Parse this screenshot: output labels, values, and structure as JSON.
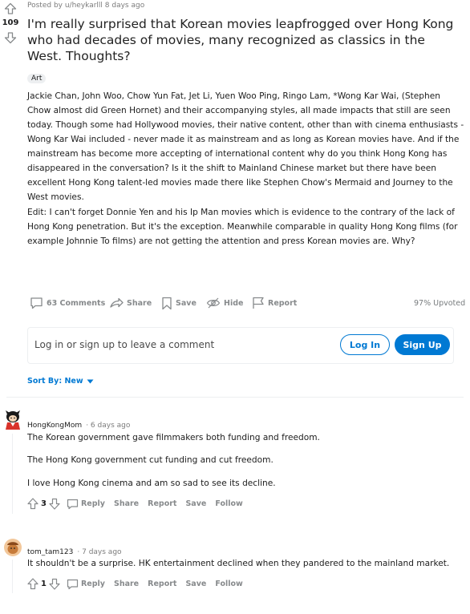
{
  "post": {
    "posted_by": "Posted by u/heykarlll 8 days ago",
    "score": "109",
    "title": "I'm really surprised that Korean movies leapfrogged over Hong Kong who had decades of movies, many recognized as classics in the West. Thoughts?",
    "flair": "Art",
    "body_p1": "Jackie Chan, John Woo, Chow Yun Fat, Jet Li, Yuen Woo Ping, Ringo Lam, *Wong Kar Wai, (Stephen Chow almost did Green Hornet) and their accompanying styles, all made impacts that still are seen today. Though some had Hollywood movies, their native content, other than with cinema enthusiasts - Wong Kar Wai included - never made it as mainstream and as long as Korean movies have. And if the mainstream has become more accepting of international content why do you think Hong Kong has disappeared in the conversation? Is it the shift to Mainland Chinese market but there have been excellent Hong Kong talent-led movies made there like Stephen Chow's Mermaid and Journey to the West movies.",
    "body_p2": "Edit: I can't forget Donnie Yen and his Ip Man movies which is evidence to the contrary of the lack of Hong Kong penetration. But it's the exception. Meanwhile comparable in quality Hong Kong films (for example Johnnie To films) are not getting the attention and press Korean movies are. Why?",
    "actions": {
      "comments": "63 Comments",
      "share": "Share",
      "save": "Save",
      "hide": "Hide",
      "report": "Report"
    },
    "upvoted": "97% Upvoted"
  },
  "login_prompt": {
    "text": "Log in or sign up to leave a comment",
    "login": "Log In",
    "signup": "Sign Up"
  },
  "sort": {
    "label": "Sort By: New"
  },
  "comments": [
    {
      "username": "HongKongMom",
      "time": "· 6 days ago",
      "paragraphs": [
        "The Korean government gave filmmakers both funding and freedom.",
        "The Hong Kong government cut funding and cut freedom.",
        "I love Hong Kong cinema and am so sad to see its decline."
      ],
      "score": "3",
      "reply": "Reply",
      "share": "Share",
      "report": "Report",
      "save": "Save",
      "follow": "Follow"
    },
    {
      "username": "tom_tam123",
      "time": "· 7 days ago",
      "paragraphs": [
        "It shouldn't be a surprise. HK entertainment declined when they pandered to the mainland market."
      ],
      "score": "1",
      "reply": "Reply",
      "share": "Share",
      "report": "Report",
      "save": "Save",
      "follow": "Follow"
    }
  ],
  "colors": {
    "accent": "#0079d3",
    "muted": "#878a8c",
    "border": "#edeff1"
  }
}
